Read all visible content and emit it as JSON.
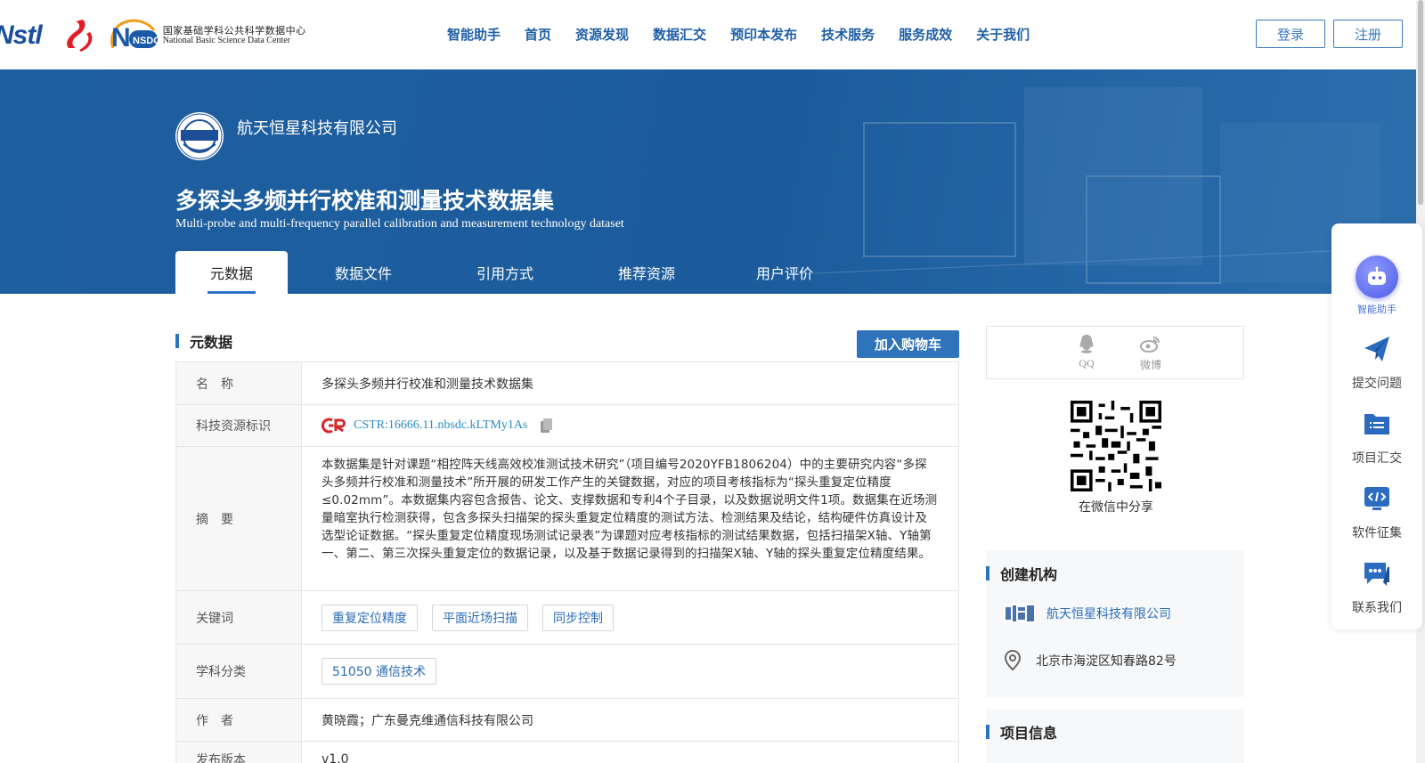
{
  "header": {
    "logos": {
      "nstl": "Nstl",
      "nsdc_mark": "NSDC",
      "nsdc_cn": "国家基础学科公共科学数据中心",
      "nsdc_en": "National Basic Science Data Center"
    },
    "nav": [
      "智能助手",
      "首页",
      "资源发现",
      "数据汇交",
      "预印本发布",
      "技术服务",
      "服务成效",
      "关于我们"
    ],
    "login_label": "登录",
    "register_label": "注册"
  },
  "banner": {
    "org_name": "航天恒星科技有限公司",
    "title_cn": "多探头多频并行校准和测量技术数据集",
    "title_en": "Multi-probe and multi-frequency parallel calibration and measurement technology dataset",
    "tabs": [
      "元数据",
      "数据文件",
      "引用方式",
      "推荐资源",
      "用户评价"
    ]
  },
  "metadata_section": {
    "heading": "元数据",
    "cart_label": "加入购物车",
    "rows": {
      "name": {
        "key": "名　称",
        "value": "多探头多频并行校准和测量技术数据集"
      },
      "cstr": {
        "key": "科技资源标识",
        "value": "CSTR:16666.11.nbsdc.kLTMy1As"
      },
      "abstract": {
        "key": "摘　要",
        "value": "本数据集是针对课题“相控阵天线高效校准测试技术研究”（项目编号2020YFB1806204）中的主要研究内容“多探头多频并行校准和测量技术”所开展的研发工作产生的关键数据，对应的项目考核指标为“探头重复定位精度≤0.02mm”。本数据集内容包含报告、论文、支撑数据和专利4个子目录，以及数据说明文件1项。数据集在近场测量暗室执行检测获得，包含多探头扫描架的探头重复定位精度的测试方法、检测结果及结论，结构硬件仿真设计及选型论证数据。“探头重复定位精度现场测试记录表”为课题对应考核指标的测试结果数据，包括扫描架X轴、Y轴第一、第二、第三次探头重复定位的数据记录，以及基于数据记录得到的扫描架X轴、Y轴的探头重复定位精度结果。"
      },
      "keywords": {
        "key": "关键词",
        "tags": [
          "重复定位精度",
          "平面近场扫描",
          "同步控制"
        ]
      },
      "subject": {
        "key": "学科分类",
        "tags": [
          "51050 通信技术"
        ]
      },
      "author": {
        "key": "作　者",
        "value": "黄晓霞；广东曼克维通信科技有限公司"
      },
      "version": {
        "key": "发布版本",
        "value": "v1.0"
      }
    }
  },
  "share": {
    "qq_label": "QQ",
    "weibo_label": "微博",
    "wechat_label": "在微信中分享"
  },
  "creator_panel": {
    "heading": "创建机构",
    "org_name": "航天恒星科技有限公司",
    "address": "北京市海淀区知春路82号"
  },
  "project_panel": {
    "heading": "项目信息"
  },
  "float_bar": {
    "items": [
      "智能助手",
      "提交问题",
      "项目汇交",
      "软件征集",
      "联系我们"
    ]
  },
  "colors": {
    "primary": "#2b73c1",
    "banner": "#1e5fa0",
    "link": "#2b6cb8"
  }
}
